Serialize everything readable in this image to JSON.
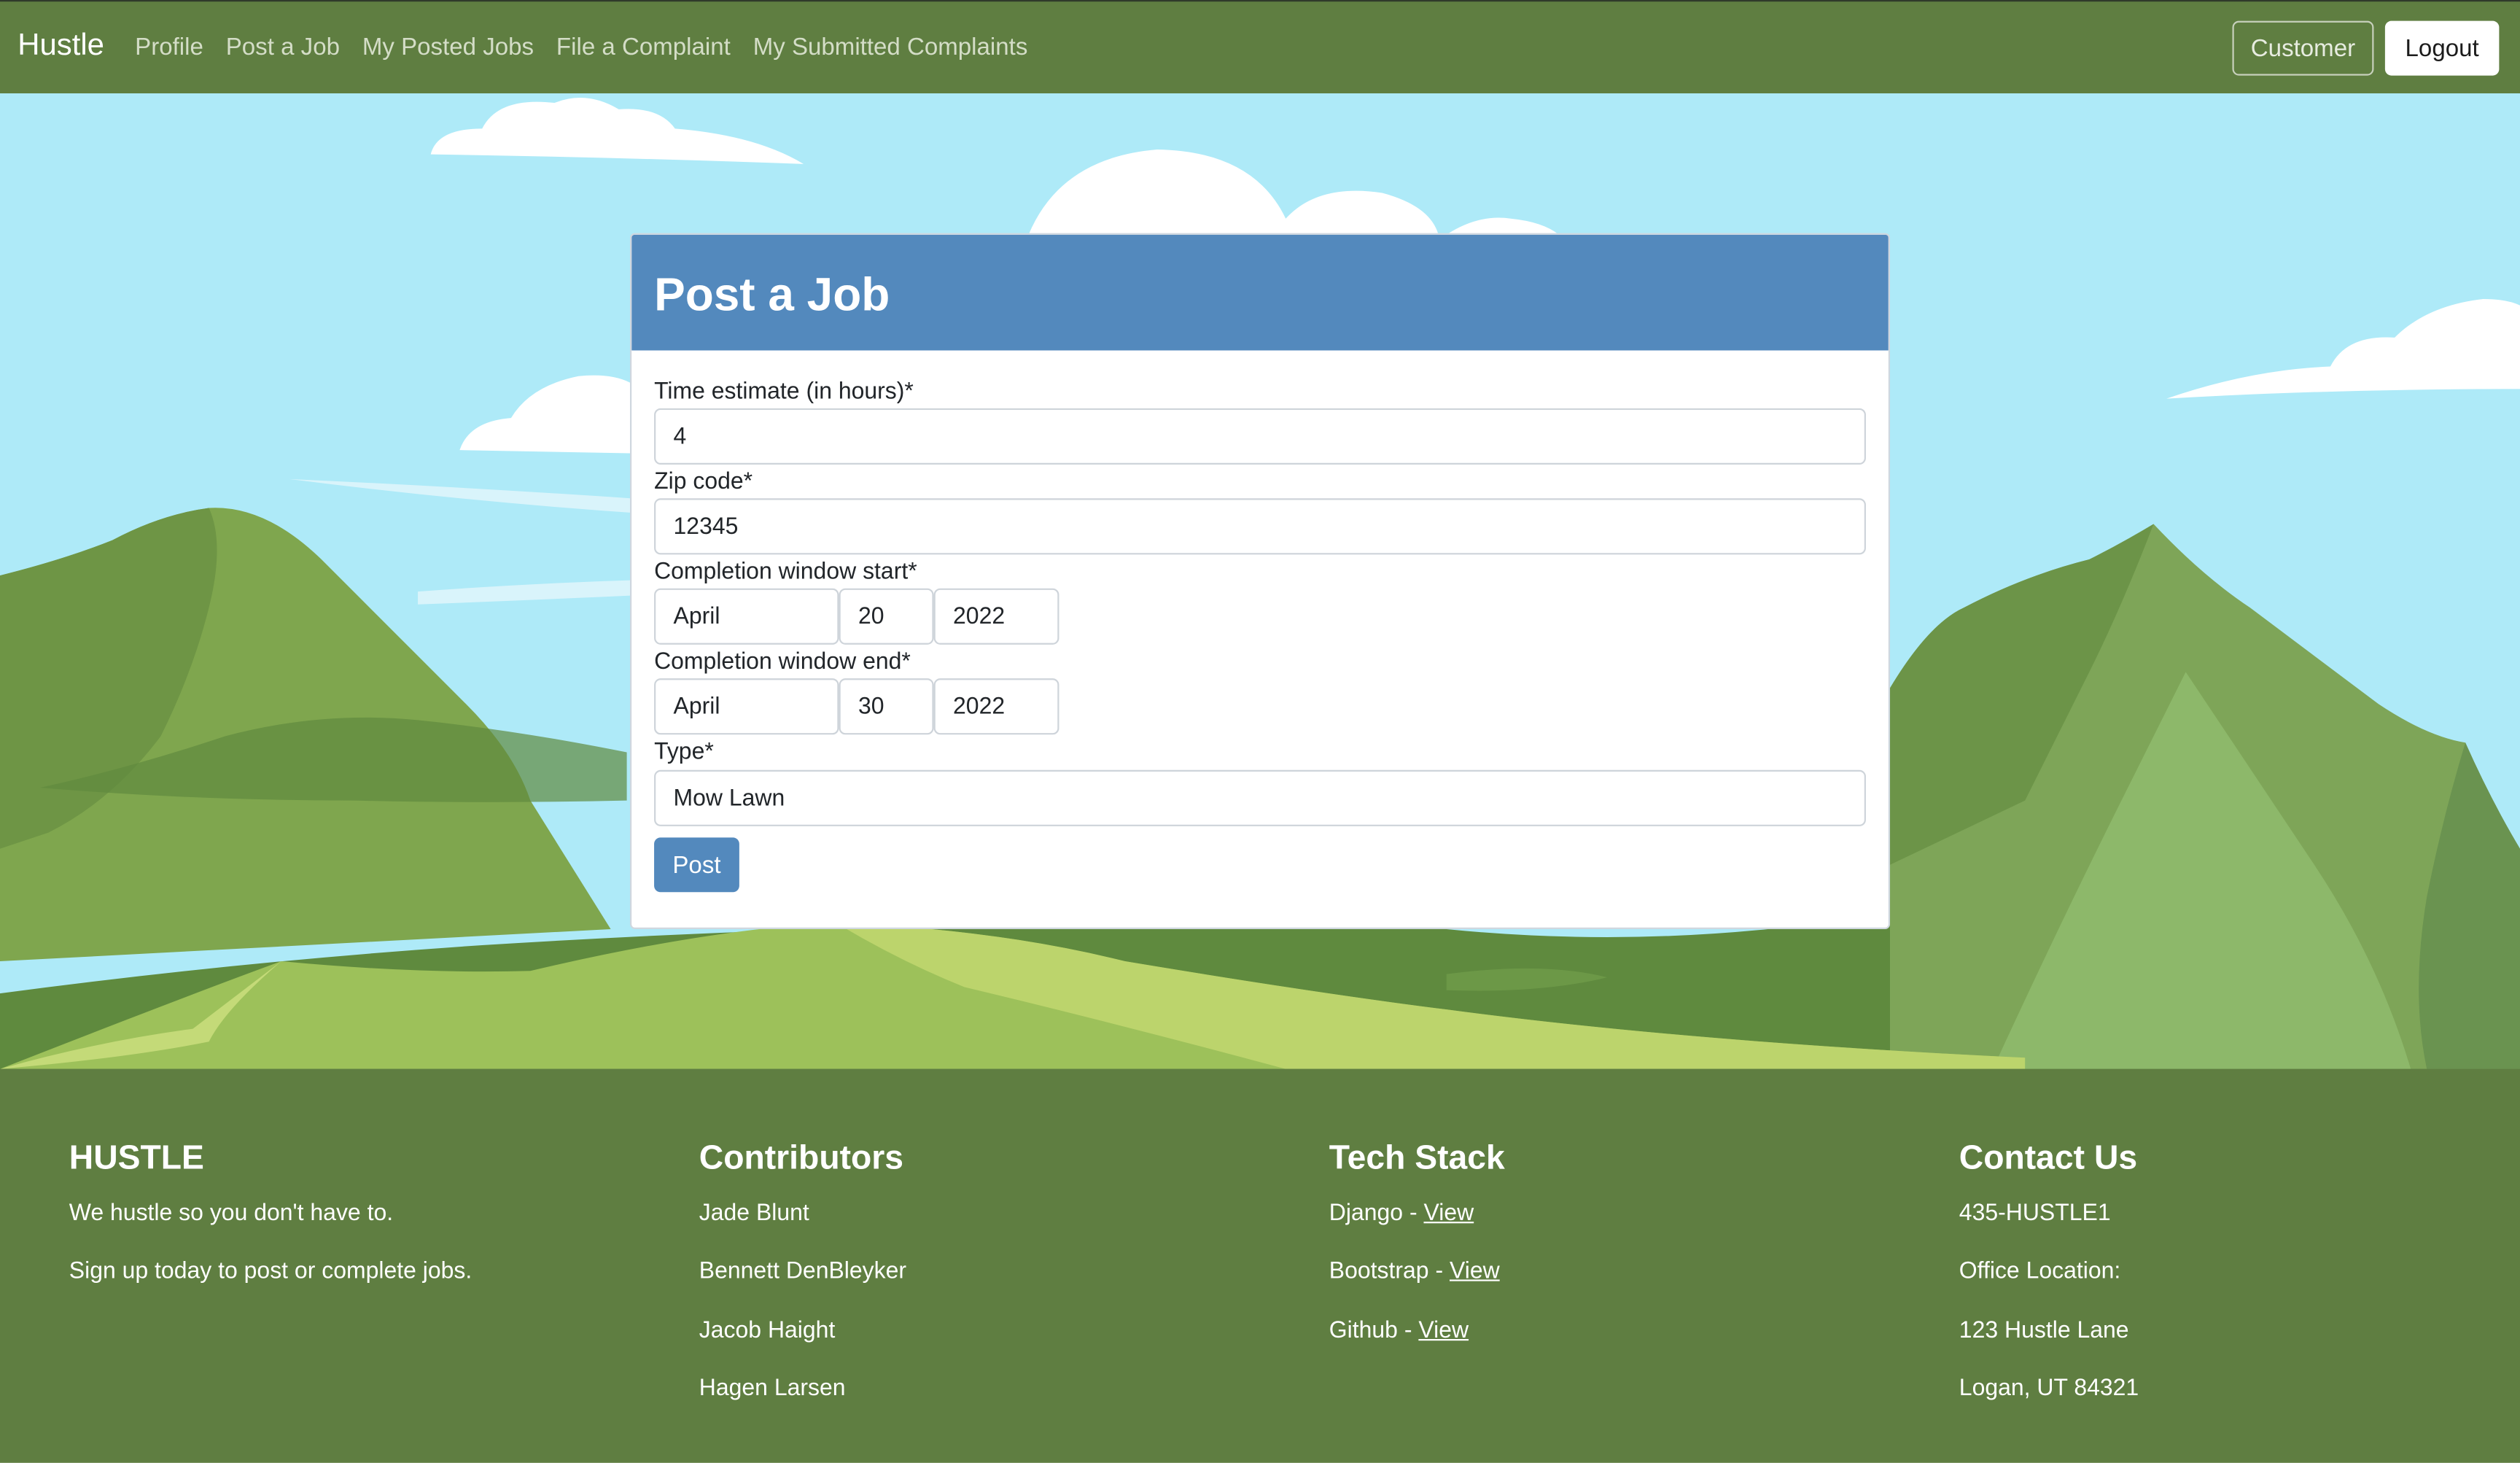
{
  "nav": {
    "brand": "Hustle",
    "links": [
      "Profile",
      "Post a Job",
      "My Posted Jobs",
      "File a Complaint",
      "My Submitted Complaints"
    ],
    "role_button": "Customer",
    "logout_button": "Logout"
  },
  "form": {
    "title": "Post a Job",
    "time_estimate_label": "Time estimate (in hours)*",
    "time_estimate_value": "4",
    "zip_label": "Zip code*",
    "zip_value": "12345",
    "start_label": "Completion window start*",
    "start_month": "April",
    "start_day": "20",
    "start_year": "2022",
    "end_label": "Completion window end*",
    "end_month": "April",
    "end_day": "30",
    "end_year": "2022",
    "type_label": "Type*",
    "type_value": "Mow Lawn",
    "submit_label": "Post"
  },
  "footer": {
    "brand": {
      "heading": "HUSTLE",
      "tagline": "We hustle so you don't have to.",
      "cta": "Sign up today to post or complete jobs."
    },
    "contributors": {
      "heading": "Contributors",
      "names": [
        "Jade Blunt",
        "Bennett DenBleyker",
        "Jacob Haight",
        "Hagen Larsen"
      ]
    },
    "tech_stack": {
      "heading": "Tech Stack",
      "items": [
        {
          "name": "Django - ",
          "link": "View"
        },
        {
          "name": "Bootstrap - ",
          "link": "View"
        },
        {
          "name": "Github - ",
          "link": "View"
        }
      ]
    },
    "contact": {
      "heading": "Contact Us",
      "phone": "435-HUSTLE1",
      "office_label": "Office Location:",
      "street": "123 Hustle Lane",
      "city": "Logan, UT 84321"
    }
  },
  "colors": {
    "nav_green": "#5f7e41",
    "card_header_blue": "#5389bd",
    "sky": "#aeeaf8"
  }
}
